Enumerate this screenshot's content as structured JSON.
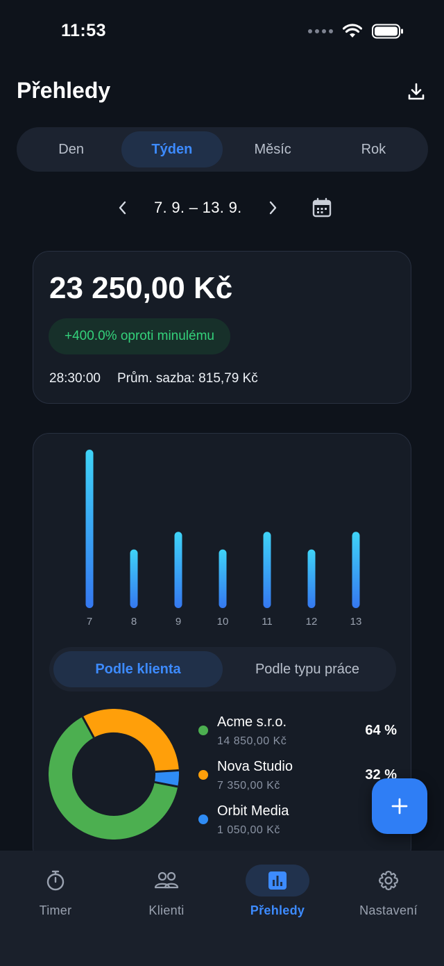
{
  "status": {
    "time": "11:53"
  },
  "header": {
    "title": "Přehledy"
  },
  "period_tabs": [
    {
      "label": "Den",
      "active": false
    },
    {
      "label": "Týden",
      "active": true
    },
    {
      "label": "Měsíc",
      "active": false
    },
    {
      "label": "Rok",
      "active": false
    }
  ],
  "date_nav": {
    "range": "7. 9. – 13. 9."
  },
  "summary": {
    "total": "23 250,00 Kč",
    "change": "+400.0% oproti minulému",
    "duration": "28:30:00",
    "avg_rate": "Prům. sazba: 815,79 Kč"
  },
  "chart_data": {
    "type": "bar",
    "categories": [
      "7",
      "8",
      "9",
      "10",
      "11",
      "12",
      "13"
    ],
    "values": [
      9,
      3.33,
      4.33,
      3.33,
      4.33,
      3.33,
      4.33
    ],
    "ylim": [
      0,
      9
    ],
    "grid": false
  },
  "breakdown": {
    "tabs": [
      {
        "label": "Podle klienta",
        "active": true
      },
      {
        "label": "Podle typu práce",
        "active": false
      }
    ],
    "items": [
      {
        "name": "Acme s.r.o.",
        "amount": "14 850,00 Kč",
        "percent": "64 %",
        "share": 0.64,
        "color": "#4caf50"
      },
      {
        "name": "Nova Studio",
        "amount": "7 350,00 Kč",
        "percent": "32 %",
        "share": 0.32,
        "color": "#ff9f0a"
      },
      {
        "name": "Orbit Media",
        "amount": "1 050,00 Kč",
        "percent": "",
        "share": 0.04,
        "color": "#2f8cf5"
      }
    ]
  },
  "colors": {
    "accent": "#3d8bff",
    "bar_top": "#3fd3f7",
    "bar_bottom": "#3578f0",
    "positive": "#34d27b"
  },
  "bottom_nav": [
    {
      "label": "Timer",
      "icon": "stopwatch-icon",
      "active": false
    },
    {
      "label": "Klienti",
      "icon": "people-icon",
      "active": false
    },
    {
      "label": "Přehledy",
      "icon": "bar-chart-icon",
      "active": true
    },
    {
      "label": "Nastavení",
      "icon": "gear-icon",
      "active": false
    }
  ]
}
